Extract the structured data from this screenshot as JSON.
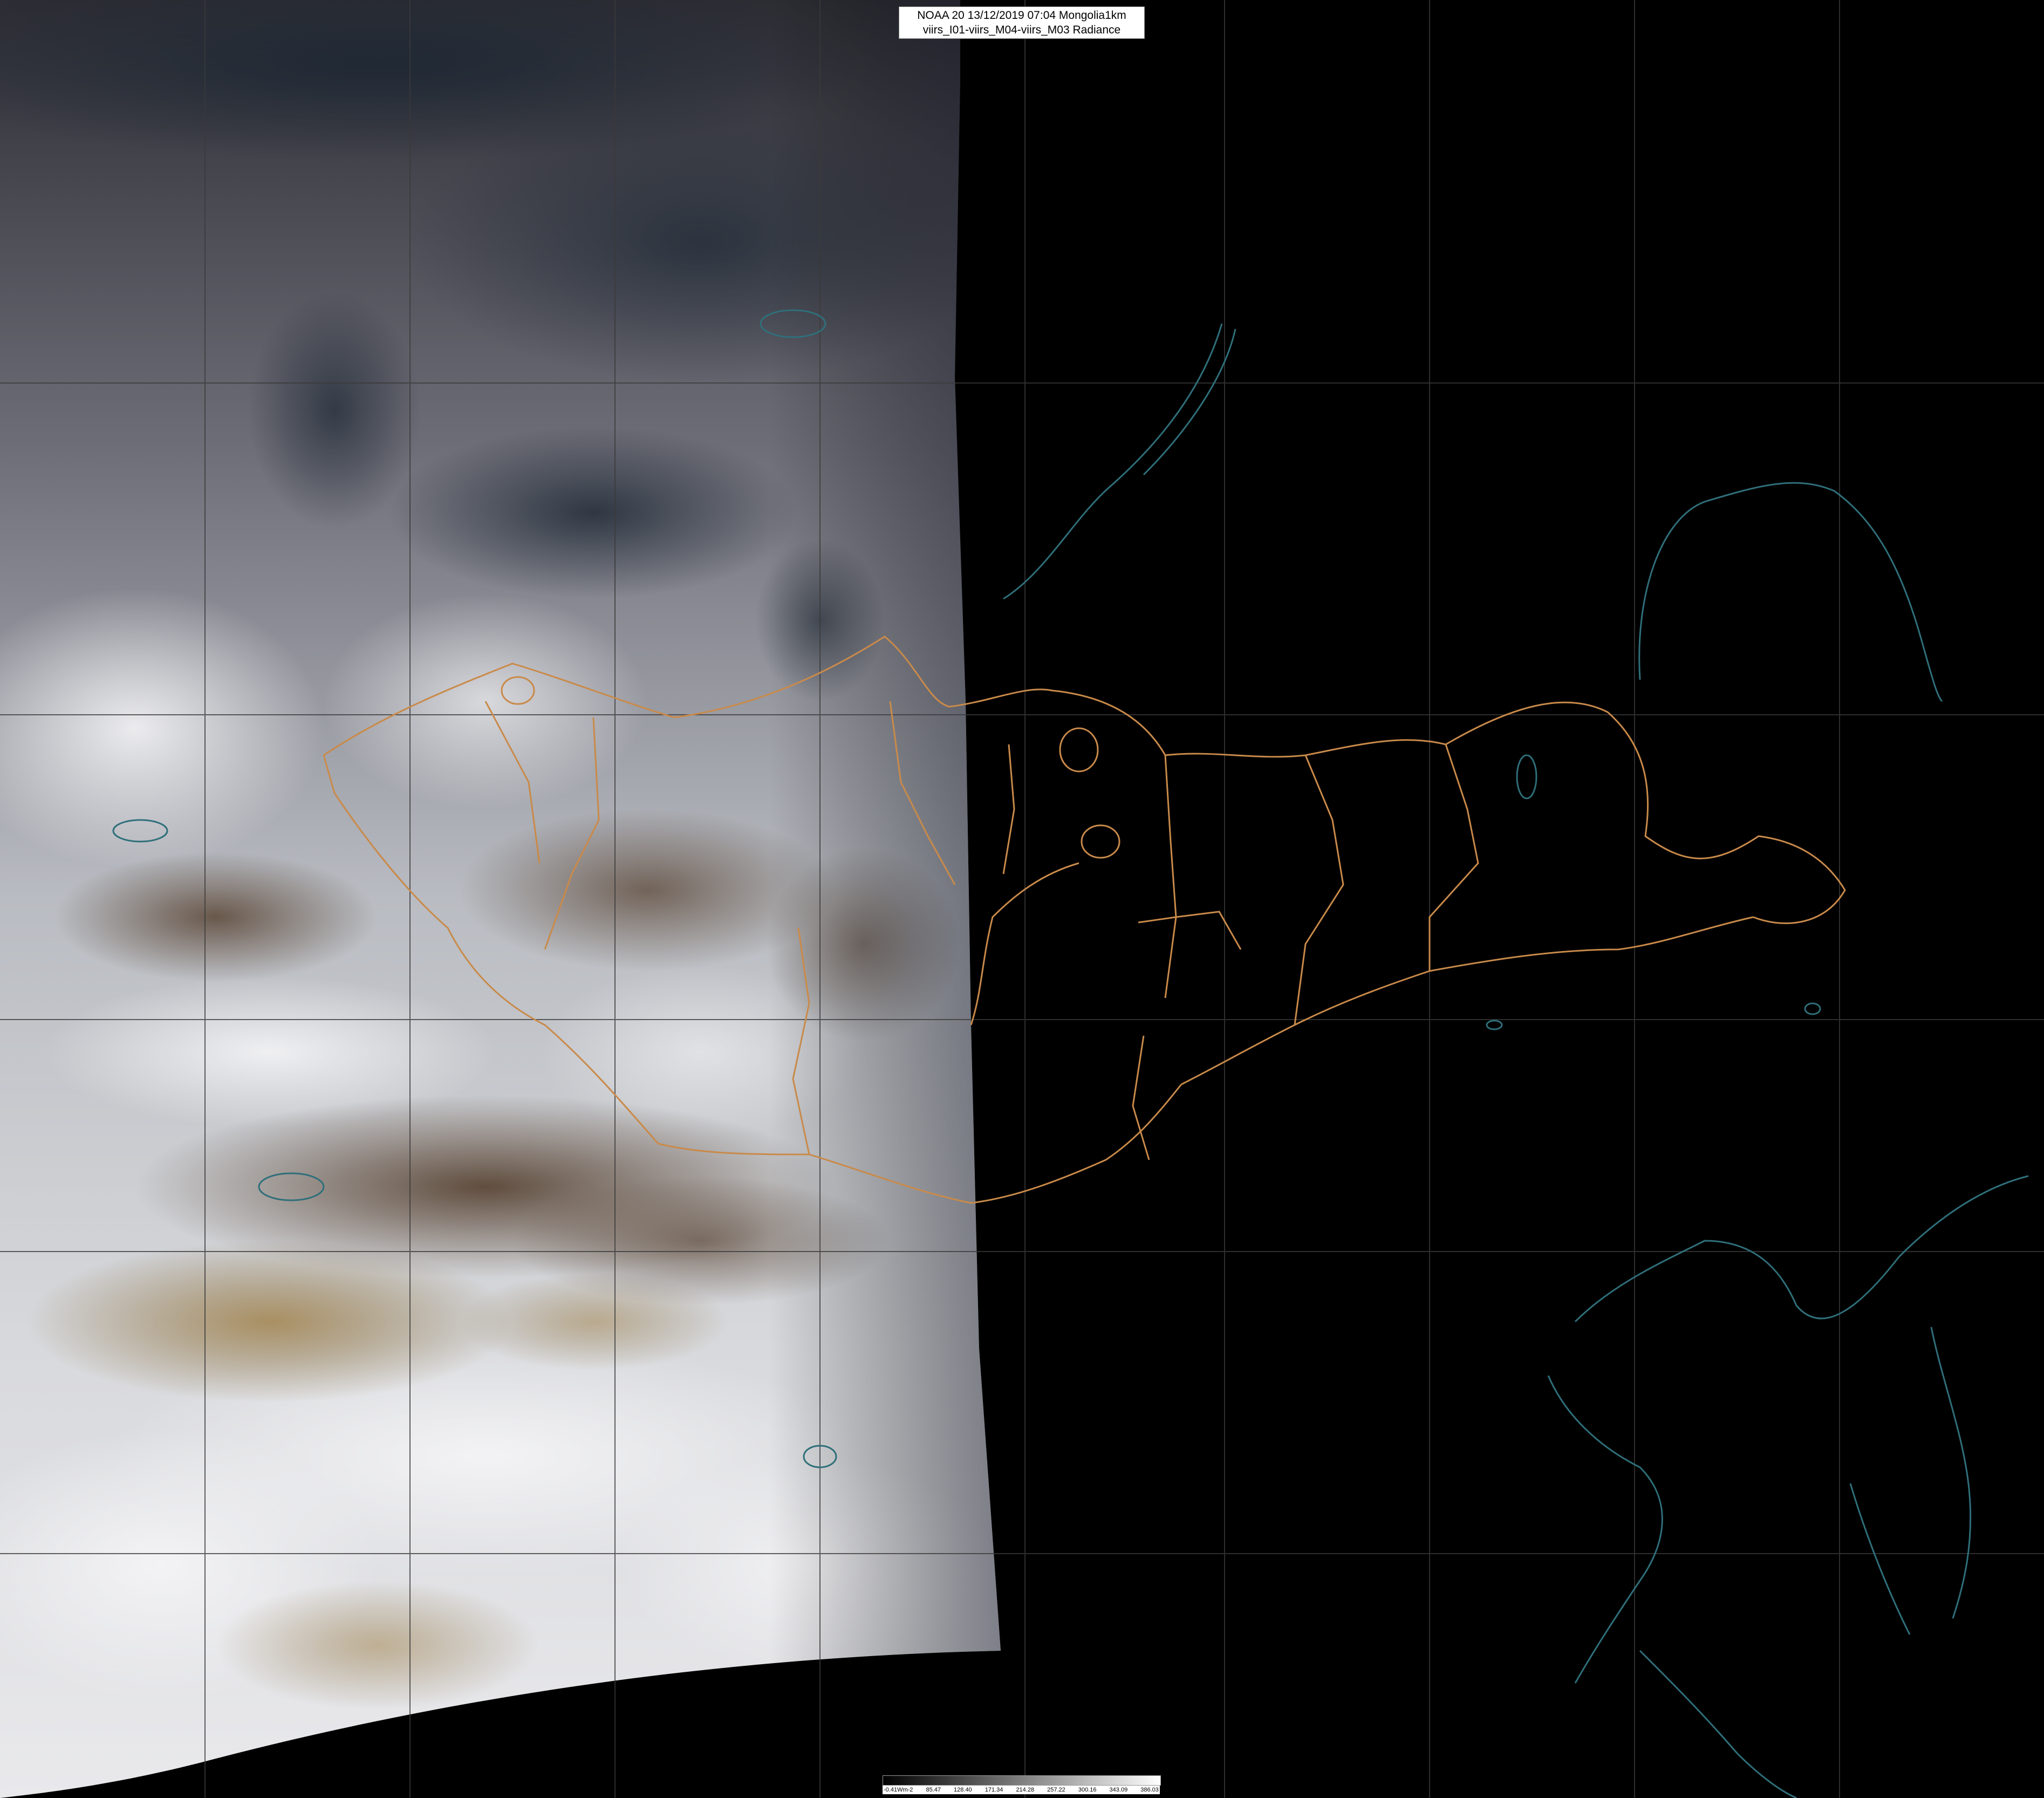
{
  "header": {
    "line1": "NOAA 20 13/12/2019 07:04 Mongolia1km",
    "line2": "viirs_I01-viirs_M04-viirs_M03 Radiance"
  },
  "colorbar": {
    "labels": [
      "-0.41Wm-2",
      "85.47",
      "128.40",
      "171.34",
      "214.28",
      "257.22",
      "300.16",
      "343.09",
      "386.03"
    ]
  },
  "colors": {
    "background": "#000000",
    "border_orange": "#c98a4a",
    "coast_cyan": "#2f6f7a",
    "grid": "#3a3a3a"
  }
}
